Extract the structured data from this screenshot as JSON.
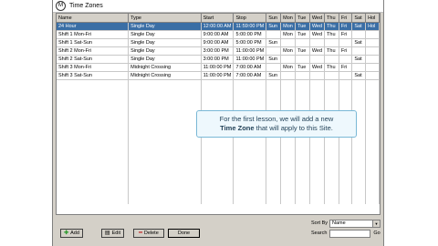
{
  "window": {
    "title": "Time Zones",
    "app_icon": "M"
  },
  "table": {
    "columns": [
      "Name",
      "Type",
      "Start",
      "Stop",
      "Sun",
      "Mon",
      "Tue",
      "Wed",
      "Thu",
      "Fri",
      "Sat",
      "Hol"
    ],
    "rows": [
      [
        "24 Hour",
        "Single Day",
        "12:00:00 AM",
        "11:59:00 PM",
        "Sun",
        "Mon",
        "Tue",
        "Wed",
        "Thu",
        "Fri",
        "Sat",
        "Hol"
      ],
      [
        "Shift 1 Mon-Fri",
        "Single Day",
        "9:00:00 AM",
        "5:00:00 PM",
        "",
        "Mon",
        "Tue",
        "Wed",
        "Thu",
        "Fri",
        "",
        ""
      ],
      [
        "Shift 1 Sat-Sun",
        "Single Day",
        "9:00:00 AM",
        "5:00:00 PM",
        "Sun",
        "",
        "",
        "",
        "",
        "",
        "Sat",
        ""
      ],
      [
        "Shift 2 Mon-Fri",
        "Single Day",
        "3:00:00 PM",
        "11:00:00 PM",
        "",
        "Mon",
        "Tue",
        "Wed",
        "Thu",
        "Fri",
        "",
        ""
      ],
      [
        "Shift 2 Sat-Sun",
        "Single Day",
        "3:00:00 PM",
        "11:00:00 PM",
        "Sun",
        "",
        "",
        "",
        "",
        "",
        "Sat",
        ""
      ],
      [
        "Shift 3 Mon-Fri",
        "Midnight Crossing",
        "11:00:00 PM",
        "7:00:00 AM",
        "",
        "Mon",
        "Tue",
        "Wed",
        "Thu",
        "Fri",
        "",
        ""
      ],
      [
        "Shift 3 Sat-Sun",
        "Midnight Crossing",
        "11:00:00 PM",
        "7:00:00 AM",
        "Sun",
        "",
        "",
        "",
        "",
        "",
        "Sat",
        ""
      ]
    ],
    "selected_row": 0
  },
  "tooltip": {
    "line1": "For the first lesson, we will add a new",
    "bold": "Time Zone",
    "line2_rest": " that will apply to this Site."
  },
  "buttons": {
    "add": "Add",
    "edit": "Edit",
    "delete": "Delete",
    "done": "Done"
  },
  "sort": {
    "label": "Sort By",
    "value": "Name"
  },
  "search": {
    "label": "Search",
    "value": "",
    "go": "Go"
  },
  "icons": {
    "add": "plus-icon",
    "edit": "edit-icon",
    "delete": "minus-icon"
  },
  "colors": {
    "selection": "#3a6ea5",
    "add_icon": "#2e9a2e",
    "delete_icon": "#c62828"
  }
}
